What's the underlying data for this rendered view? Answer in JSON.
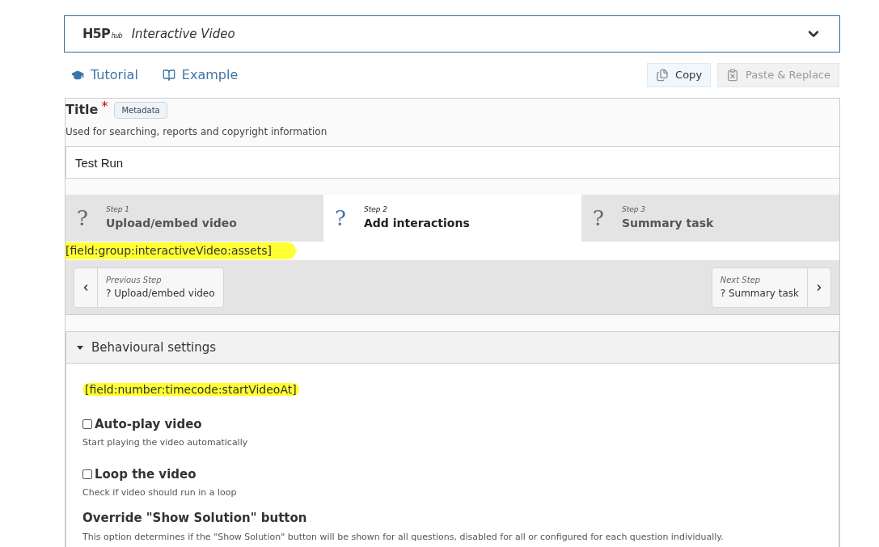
{
  "hub": {
    "logo": "H5P",
    "logo_sub": "hub",
    "title": "Interactive Video"
  },
  "links": [
    {
      "label": "Tutorial",
      "kind": "tutorial"
    },
    {
      "label": "Example",
      "kind": "example"
    }
  ],
  "actions": [
    {
      "label": "Copy",
      "disabled": false
    },
    {
      "label": "Paste & Replace",
      "disabled": true
    }
  ],
  "title_field": {
    "label": "Title",
    "required_mark": "*",
    "metadata": "Metadata",
    "description": "Used for searching, reports and copyright information",
    "value": "Test Run"
  },
  "steps": [
    {
      "step": "Step 1",
      "label": "Upload/embed video",
      "icon": "?",
      "selected": false
    },
    {
      "step": "Step 2",
      "label": "Add interactions",
      "icon": "?",
      "selected": true
    },
    {
      "step": "Step 3",
      "label": "Summary task",
      "icon": "?",
      "selected": false
    }
  ],
  "assets_field": "[field:group:interactiveVideo:assets]",
  "nav": {
    "previous": {
      "caption": "Previous Step",
      "icon": "?",
      "label": "Upload/embed video"
    },
    "next": {
      "caption": "Next Step",
      "icon": "?",
      "label": "Summary task"
    }
  },
  "behaviour": {
    "title": "Behavioural settings",
    "expanded": true,
    "timecode_field": "[field:number:timecode:startVideoAt]",
    "options": [
      {
        "label": "Auto-play video",
        "description": "Start playing the video automatically",
        "checked": false
      },
      {
        "label": "Loop the video",
        "description": "Check if video should run in a loop",
        "checked": false
      }
    ],
    "override_title": "Override \"Show Solution\" button",
    "override_description": "This option determines if the \"Show Solution\" button will be shown for all questions, disabled for all or configured for each question individually."
  }
}
